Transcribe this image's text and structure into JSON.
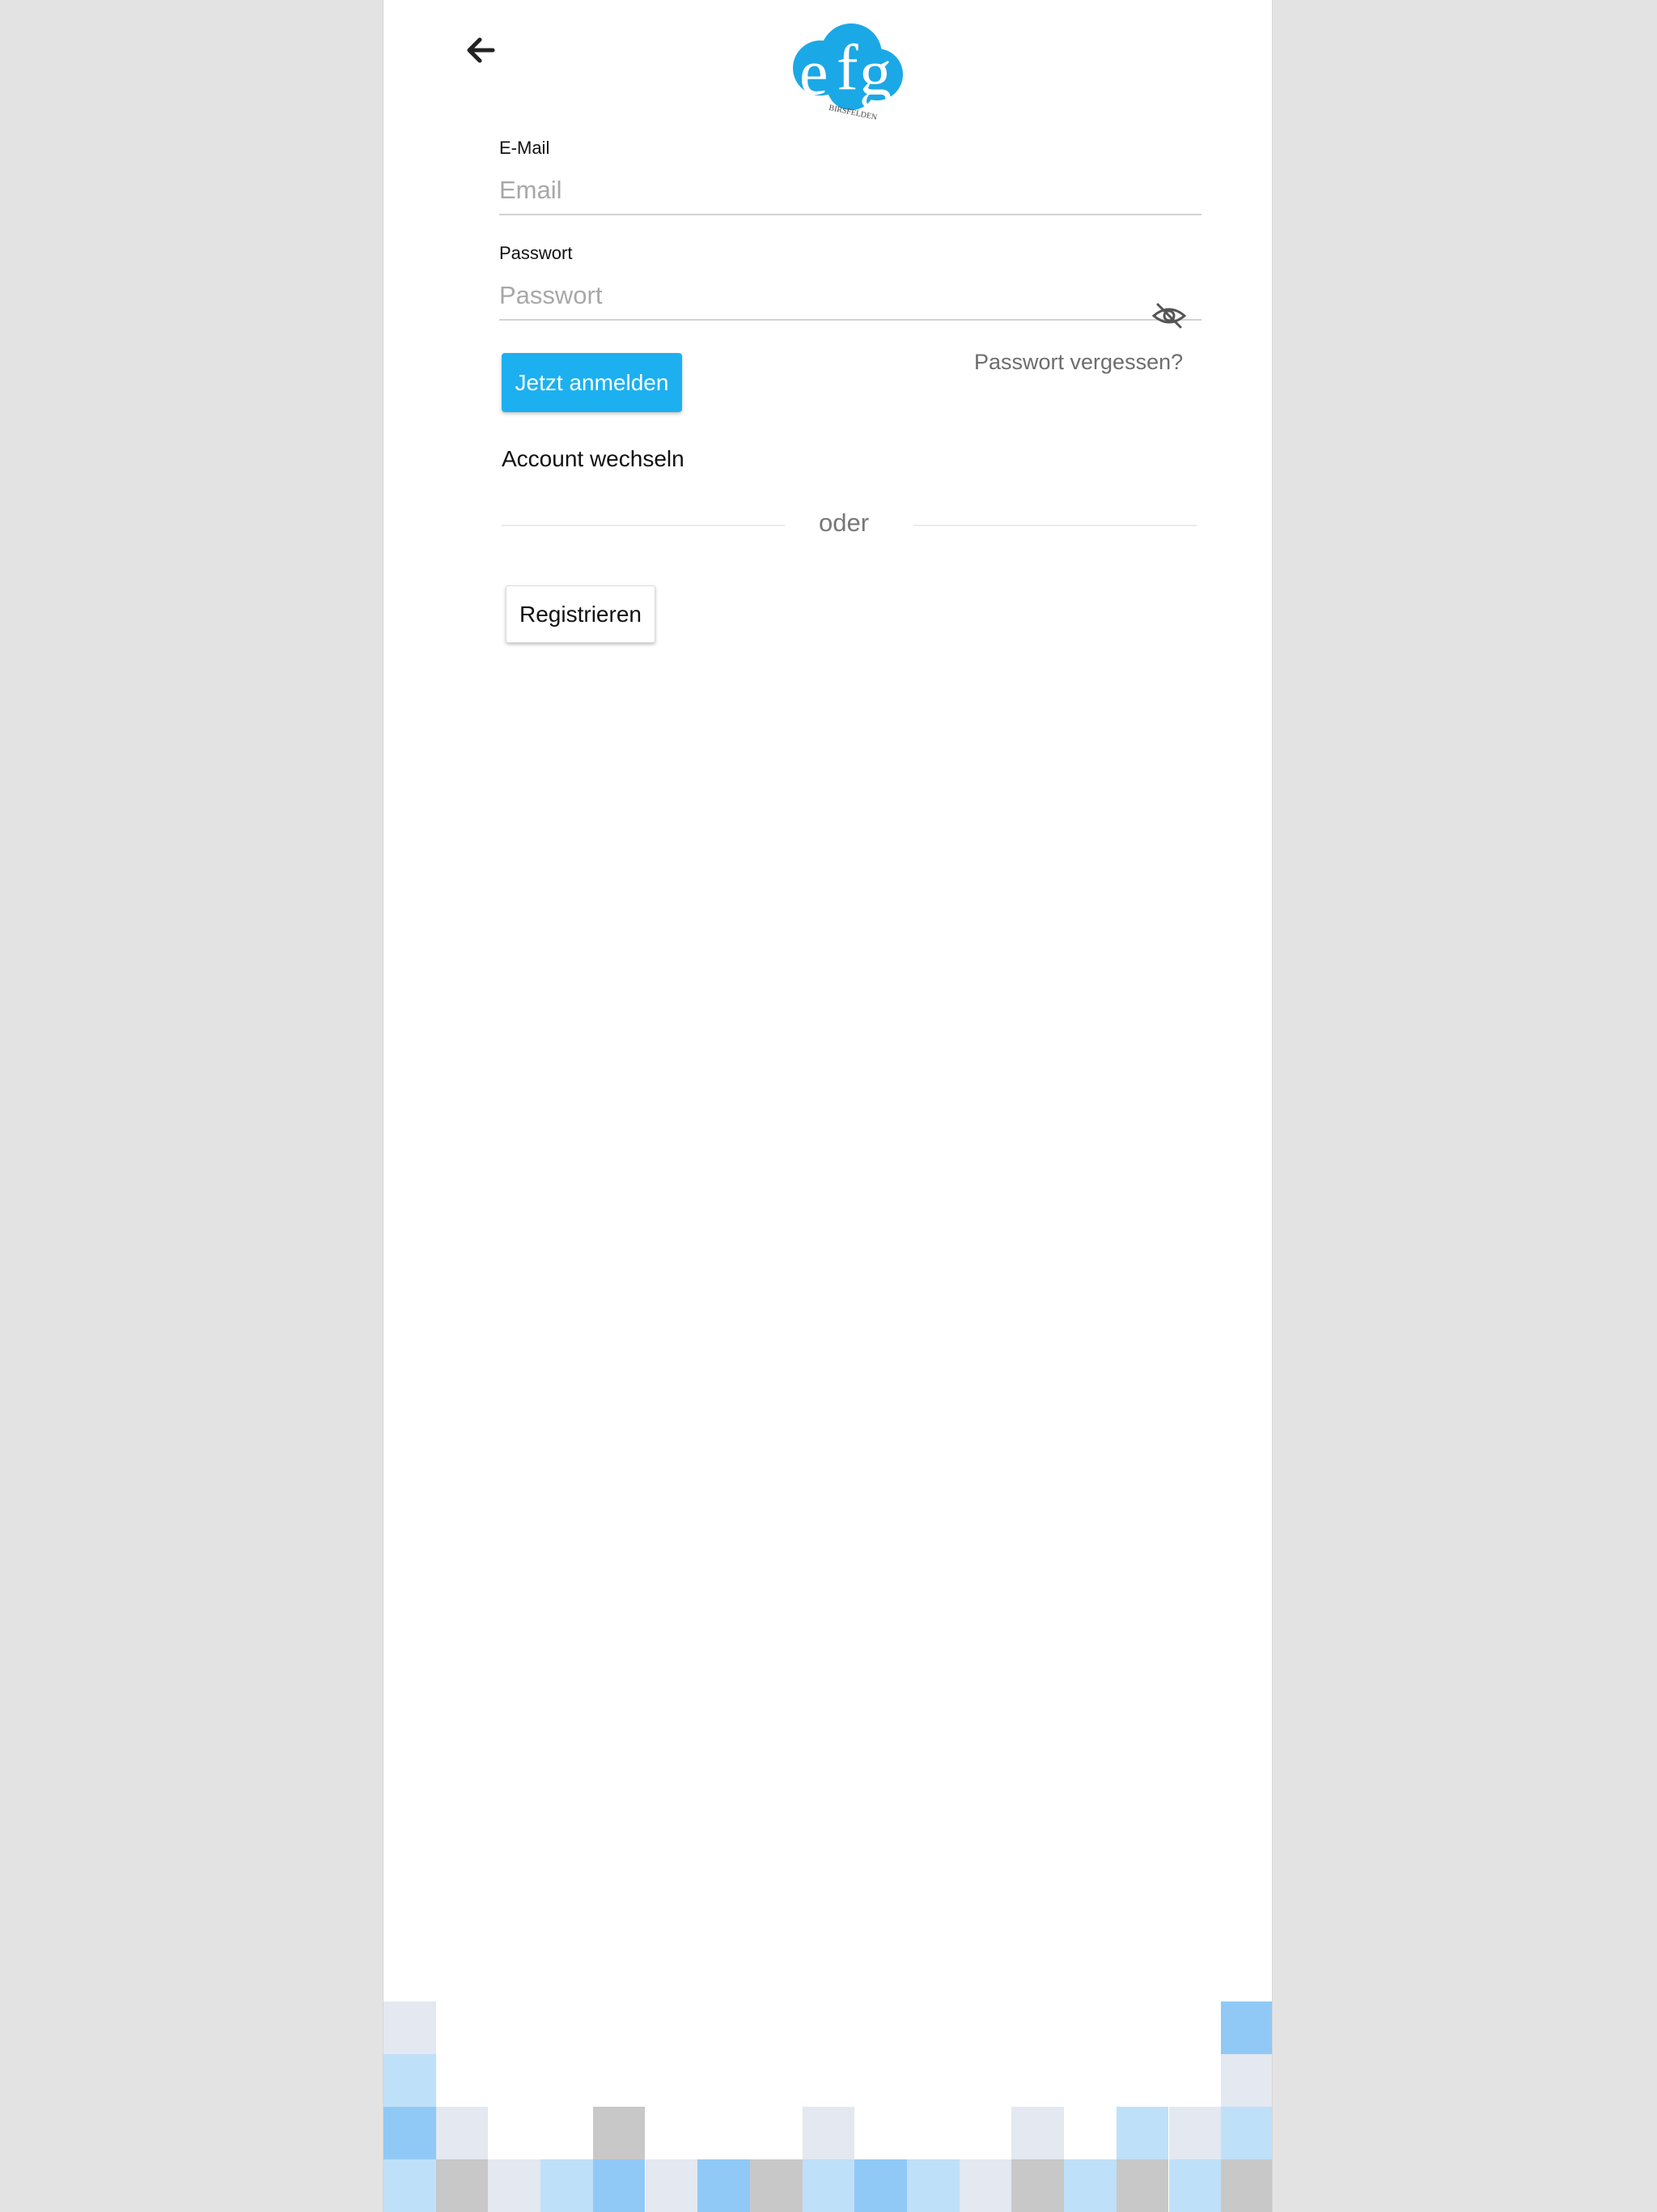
{
  "header": {
    "back_icon": "arrow-left-icon",
    "logo_text": "efg",
    "logo_subtext": "BIRSFELDEN"
  },
  "form": {
    "email": {
      "label": "E-Mail",
      "placeholder": "Email",
      "value": ""
    },
    "password": {
      "label": "Passwort",
      "placeholder": "Passwort",
      "value": "",
      "toggle_icon": "eye-off-icon"
    },
    "login_button": "Jetzt anmelden",
    "forgot_link": "Passwort vergessen?",
    "switch_account": "Account wechseln",
    "divider": "oder",
    "register_button": "Registrieren"
  },
  "colors": {
    "accent": "#1cb0f0",
    "background": "#e3e3e3",
    "mosaic": {
      "light_gray": "#e3e8f1",
      "light_blue": "#bfe0f9",
      "mid_blue": "#90c9f6",
      "gray": "#c8c8c8"
    }
  }
}
